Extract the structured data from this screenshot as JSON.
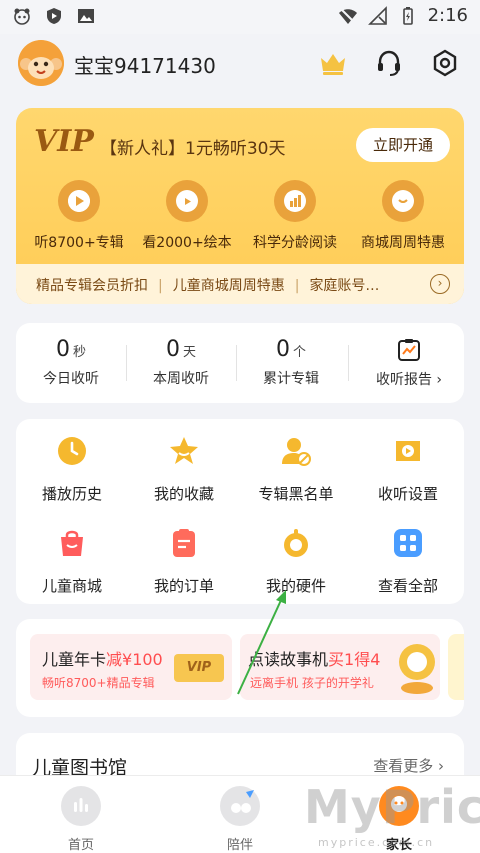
{
  "status_bar": {
    "time": "2:16",
    "left_icons": [
      "panda-icon",
      "shield-icon",
      "image-icon"
    ],
    "right_icons": [
      "wifi-icon",
      "signal-icon",
      "battery-icon"
    ]
  },
  "header": {
    "username": "宝宝94171430",
    "icons": [
      "crown-icon",
      "headset-icon",
      "settings-icon"
    ]
  },
  "vip": {
    "logo": "VIP",
    "promo": "【新人礼】1元畅听30天",
    "open_button": "立即开通",
    "features": [
      {
        "label": "听8700+专辑",
        "icon": "play-icon"
      },
      {
        "label": "看2000+绘本",
        "icon": "video-icon"
      },
      {
        "label": "科学分龄阅读",
        "icon": "chart-icon"
      },
      {
        "label": "商城周周特惠",
        "icon": "gift-icon"
      }
    ],
    "links": [
      "精品专辑会员折扣",
      "儿童商城周周特惠",
      "家庭账号…"
    ],
    "more_icon": "arrow-right-circle-icon"
  },
  "stats": [
    {
      "value": "0",
      "unit": "秒",
      "label": "今日收听"
    },
    {
      "value": "0",
      "unit": "天",
      "label": "本周收听"
    },
    {
      "value": "0",
      "unit": "个",
      "label": "累计专辑"
    }
  ],
  "report": {
    "label": "收听报告",
    "arrow": "›",
    "icon": "report-icon"
  },
  "functions": [
    {
      "label": "播放历史",
      "icon": "history-icon",
      "color": "#f5b82e"
    },
    {
      "label": "我的收藏",
      "icon": "star-icon",
      "color": "#f5b82e"
    },
    {
      "label": "专辑黑名单",
      "icon": "user-block-icon",
      "color": "#f5b82e"
    },
    {
      "label": "收听设置",
      "icon": "listen-settings-icon",
      "color": "#f5b82e"
    },
    {
      "label": "儿童商城",
      "icon": "shopping-bag-icon",
      "color": "#ff5c5c"
    },
    {
      "label": "我的订单",
      "icon": "order-icon",
      "color": "#ff6b5c"
    },
    {
      "label": "我的硬件",
      "icon": "hardware-icon",
      "color": "#f5b82e"
    },
    {
      "label": "查看全部",
      "icon": "grid-icon",
      "color": "#4a9dff"
    }
  ],
  "promos": [
    {
      "title": "儿童年卡",
      "highlight": "减¥100",
      "subtitle": "畅听8700+精品专辑",
      "badge": "VIP"
    },
    {
      "title": "点读故事机",
      "highlight": "买1得4",
      "subtitle": "远离手机 孩子的开学礼"
    }
  ],
  "library": {
    "title": "儿童图书馆",
    "more": "查看更多",
    "arrow": "›"
  },
  "tabs": [
    {
      "label": "首页",
      "icon": "home-icon",
      "active": false
    },
    {
      "label": "陪伴",
      "icon": "companion-icon",
      "active": false
    },
    {
      "label": "家长",
      "icon": "parent-icon",
      "active": true
    }
  ],
  "watermark": {
    "main": "MyPrice",
    "sub": "myprice.com.cn"
  },
  "colors": {
    "accent": "#ffcc55",
    "highlight": "#ff4d4f",
    "annotation_arrow": "#3cb043",
    "active_tab": "#ff8a1f"
  }
}
